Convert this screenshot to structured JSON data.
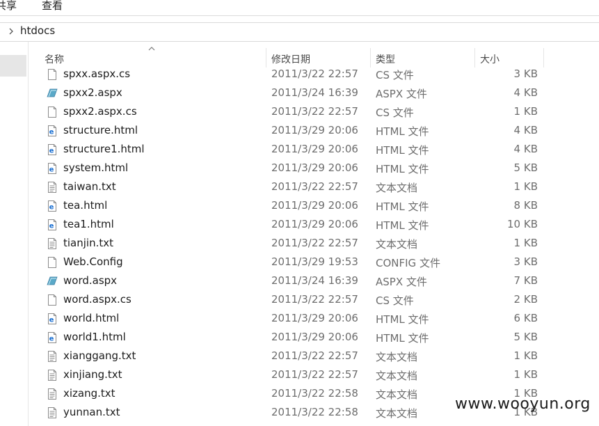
{
  "ribbon": {
    "tabs": [
      "共享",
      "查看"
    ]
  },
  "address": {
    "path": "htdocs"
  },
  "columns": {
    "name": "名称",
    "date": "修改日期",
    "type": "类型",
    "size": "大小"
  },
  "files": [
    {
      "name": "spxx.aspx.cs",
      "date": "2011/3/22 22:57",
      "type": "CS 文件",
      "size": "3 KB",
      "icon": "file-icon"
    },
    {
      "name": "spxx2.aspx",
      "date": "2011/3/24 16:39",
      "type": "ASPX 文件",
      "size": "4 KB",
      "icon": "aspx-file-icon"
    },
    {
      "name": "spxx2.aspx.cs",
      "date": "2011/3/22 22:57",
      "type": "CS 文件",
      "size": "1 KB",
      "icon": "file-icon"
    },
    {
      "name": "structure.html",
      "date": "2011/3/29 20:06",
      "type": "HTML 文件",
      "size": "4 KB",
      "icon": "html-file-icon"
    },
    {
      "name": "structure1.html",
      "date": "2011/3/29 20:06",
      "type": "HTML 文件",
      "size": "4 KB",
      "icon": "html-file-icon"
    },
    {
      "name": "system.html",
      "date": "2011/3/29 20:06",
      "type": "HTML 文件",
      "size": "5 KB",
      "icon": "html-file-icon"
    },
    {
      "name": "taiwan.txt",
      "date": "2011/3/22 22:57",
      "type": "文本文档",
      "size": "1 KB",
      "icon": "text-file-icon"
    },
    {
      "name": "tea.html",
      "date": "2011/3/29 20:06",
      "type": "HTML 文件",
      "size": "8 KB",
      "icon": "html-file-icon"
    },
    {
      "name": "tea1.html",
      "date": "2011/3/29 20:06",
      "type": "HTML 文件",
      "size": "10 KB",
      "icon": "html-file-icon"
    },
    {
      "name": "tianjin.txt",
      "date": "2011/3/22 22:57",
      "type": "文本文档",
      "size": "1 KB",
      "icon": "text-file-icon"
    },
    {
      "name": "Web.Config",
      "date": "2011/3/29 19:53",
      "type": "CONFIG 文件",
      "size": "3 KB",
      "icon": "file-icon"
    },
    {
      "name": "word.aspx",
      "date": "2011/3/24 16:39",
      "type": "ASPX 文件",
      "size": "7 KB",
      "icon": "aspx-file-icon"
    },
    {
      "name": "word.aspx.cs",
      "date": "2011/3/22 22:57",
      "type": "CS 文件",
      "size": "2 KB",
      "icon": "file-icon"
    },
    {
      "name": "world.html",
      "date": "2011/3/29 20:06",
      "type": "HTML 文件",
      "size": "6 KB",
      "icon": "html-file-icon"
    },
    {
      "name": "world1.html",
      "date": "2011/3/29 20:06",
      "type": "HTML 文件",
      "size": "5 KB",
      "icon": "html-file-icon"
    },
    {
      "name": "xianggang.txt",
      "date": "2011/3/22 22:57",
      "type": "文本文档",
      "size": "1 KB",
      "icon": "text-file-icon"
    },
    {
      "name": "xinjiang.txt",
      "date": "2011/3/22 22:57",
      "type": "文本文档",
      "size": "1 KB",
      "icon": "text-file-icon"
    },
    {
      "name": "xizang.txt",
      "date": "2011/3/22 22:58",
      "type": "文本文档",
      "size": "1 KB",
      "icon": "text-file-icon"
    },
    {
      "name": "yunnan.txt",
      "date": "2011/3/22 22:58",
      "type": "文本文档",
      "size": "1 KB",
      "icon": "text-file-icon"
    }
  ],
  "watermark": "www.wooyun.org",
  "colors": {
    "html_icon": "#1a6fd1",
    "aspx_icon": "#5aa9c8",
    "header_sep": "#e5e5e5",
    "nav_selected": "#e6e6e6"
  }
}
